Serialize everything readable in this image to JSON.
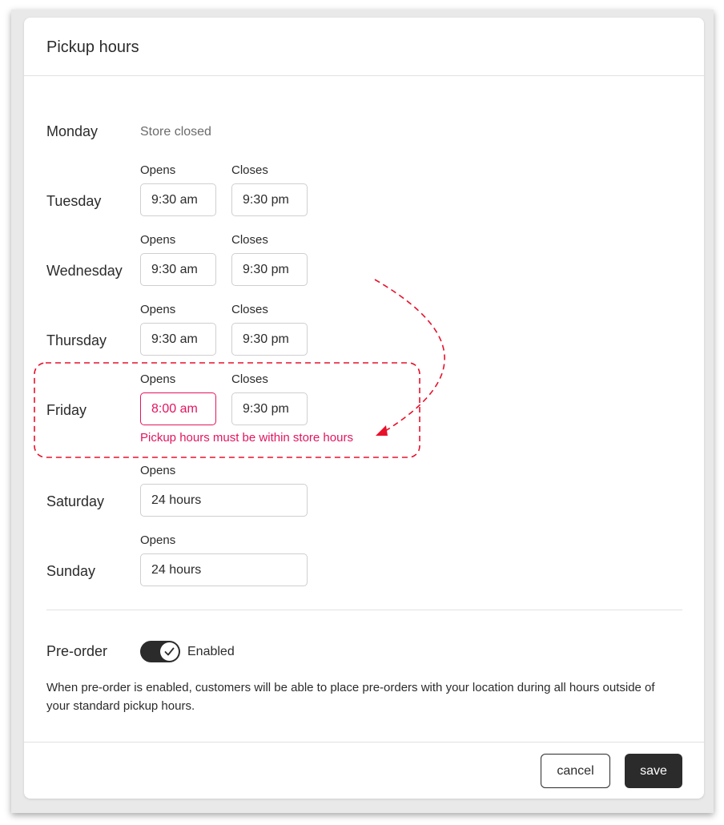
{
  "dialog": {
    "title": "Pickup hours"
  },
  "days": {
    "monday": {
      "label": "Monday",
      "status": "Store closed"
    },
    "tuesday": {
      "label": "Tuesday",
      "opens_label": "Opens",
      "closes_label": "Closes",
      "opens": "9:30 am",
      "closes": "9:30 pm"
    },
    "wednesday": {
      "label": "Wednesday",
      "opens_label": "Opens",
      "closes_label": "Closes",
      "opens": "9:30 am",
      "closes": "9:30 pm"
    },
    "thursday": {
      "label": "Thursday",
      "opens_label": "Opens",
      "closes_label": "Closes",
      "opens": "9:30 am",
      "closes": "9:30 pm"
    },
    "friday": {
      "label": "Friday",
      "opens_label": "Opens",
      "closes_label": "Closes",
      "opens": "8:00 am",
      "closes": "9:30 pm",
      "error": "Pickup hours must be within store hours"
    },
    "saturday": {
      "label": "Saturday",
      "opens_label": "Opens",
      "opens": "24 hours"
    },
    "sunday": {
      "label": "Sunday",
      "opens_label": "Opens",
      "opens": "24 hours"
    }
  },
  "preorder": {
    "label": "Pre-order",
    "toggle_state": "Enabled",
    "enabled": true,
    "description": "When pre-order is enabled, customers will be able to place pre-orders with your location during all hours outside of your standard pickup hours."
  },
  "footer": {
    "cancel_label": "cancel",
    "save_label": "save"
  },
  "colors": {
    "error": "#e2155f",
    "dark": "#2b2b2b",
    "annotation": "#e8102b"
  },
  "icons": {
    "toggle": "check-icon"
  }
}
